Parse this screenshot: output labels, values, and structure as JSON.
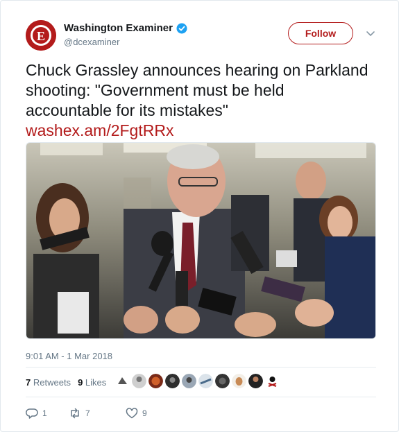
{
  "account": {
    "display_name": "Washington Examiner",
    "handle": "@dcexaminer",
    "follow_label": "Follow",
    "brand_color": "#b31b1b",
    "verified_color": "#1da1f2"
  },
  "tweet": {
    "text": "Chuck Grassley announces hearing on Parkland shooting: \"Government must be held accountable for its mistakes\"",
    "link": "washex.am/2FgtRRx",
    "timestamp": "9:01 AM - 1 Mar 2018"
  },
  "stats": {
    "retweets_count": "7",
    "retweets_label": "Retweets",
    "likes_count": "9",
    "likes_label": "Likes"
  },
  "actions": {
    "reply_count": "1",
    "retweet_count": "7",
    "like_count": "9"
  },
  "icons": [
    "verified-badge-icon",
    "caret-down-icon",
    "reply-icon",
    "retweet-icon",
    "heart-icon"
  ]
}
